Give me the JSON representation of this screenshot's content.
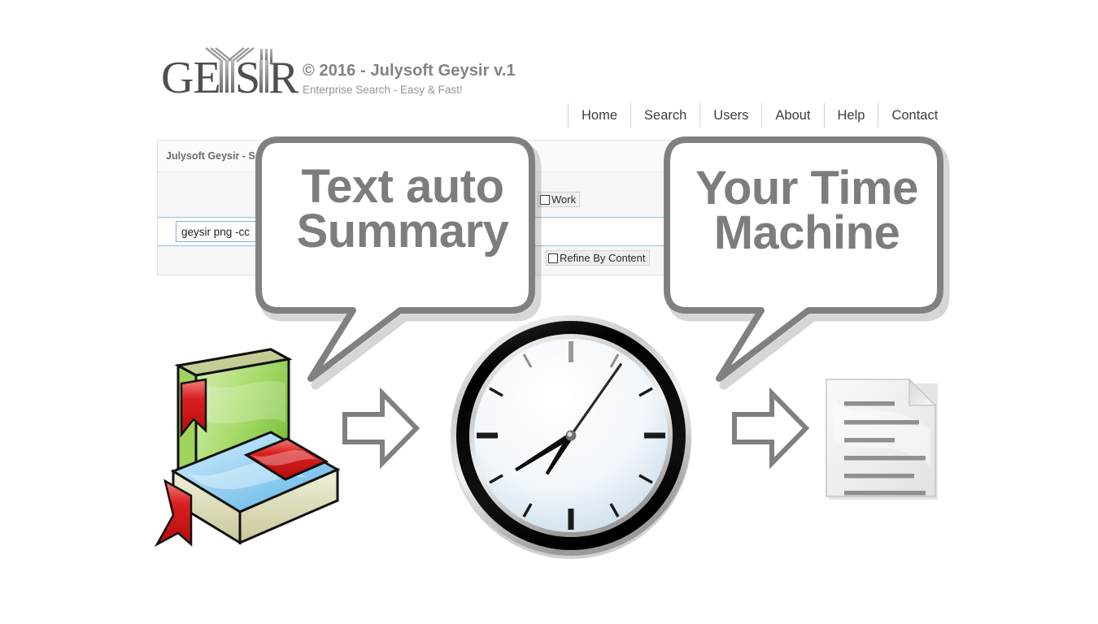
{
  "header": {
    "logo_text": "GEYSIR",
    "logo_name": "geysir-logo",
    "title": "© 2016 - Julysoft Geysir v.1",
    "subtitle": "Enterprise Search - Easy & Fast!"
  },
  "nav": {
    "items": [
      {
        "label": "Home"
      },
      {
        "label": "Search"
      },
      {
        "label": "Users"
      },
      {
        "label": "About"
      },
      {
        "label": "Help"
      },
      {
        "label": "Contact"
      }
    ]
  },
  "panel": {
    "title": "Julysoft Geysir - Se",
    "search": {
      "value": "geysir png -cc",
      "placeholder": "geysir png -cc"
    },
    "checkboxes": [
      {
        "label": "Work",
        "checked": false
      },
      {
        "label": "Refine By Content",
        "checked": false
      }
    ]
  },
  "bubbles": [
    {
      "name": "bubble-text-auto-summary",
      "line1": "Text auto",
      "line2": "Summary"
    },
    {
      "name": "bubble-your-time-machine",
      "line1": "Your Time",
      "line2": "Machine"
    }
  ],
  "illustration": {
    "books_icon": "books-icon",
    "arrow1_icon": "arrow-right-icon",
    "clock_icon": "clock-icon",
    "arrow2_icon": "arrow-right-icon",
    "document_icon": "document-icon",
    "clock": {
      "hour_hand_deg": 238,
      "minute_hand_deg": 212,
      "second_hand_deg": 35
    }
  },
  "colors": {
    "brand_text": "#8a817c",
    "nav_text": "#3d3d3d",
    "panel_bg": "#f6f6f6",
    "input_border": "#7fb7d6",
    "bubble_stroke": "#808080",
    "bubble_text": "#7d7d7d",
    "book_green": "#7fc241",
    "book_blue": "#6ab9e8",
    "bookmark_red": "#d41b1b"
  }
}
